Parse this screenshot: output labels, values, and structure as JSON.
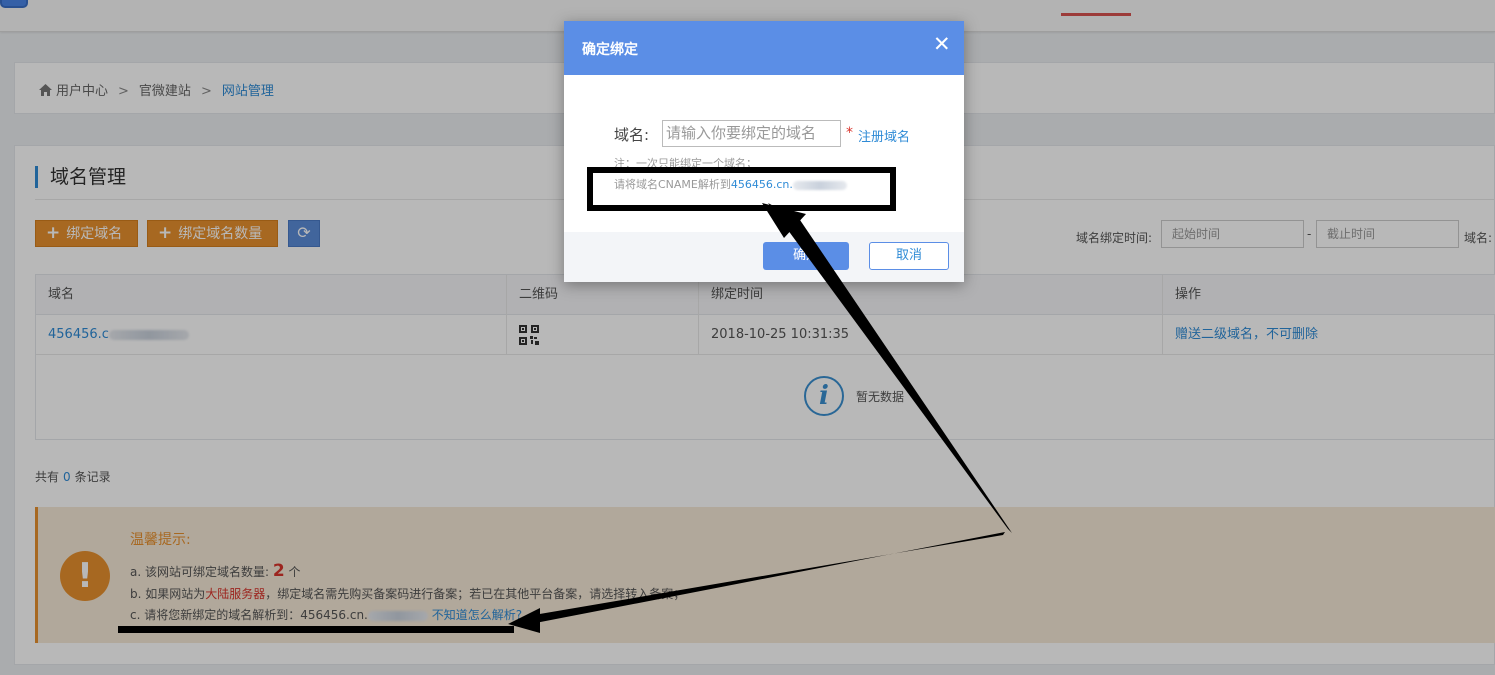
{
  "breadcrumb": {
    "home": "用户中心",
    "separator": ">",
    "mid": "官微建站",
    "current": "网站管理"
  },
  "section": {
    "title": "域名管理"
  },
  "toolbar": {
    "bind_domain": "绑定域名",
    "bind_quantity": "绑定域名数量",
    "refresh_icon": "refresh-icon",
    "bind_time_label": "域名绑定时间:",
    "start_placeholder": "起始时间",
    "range_dash": "-",
    "end_placeholder": "截止时间",
    "domain_label": "域名:"
  },
  "table": {
    "headers": [
      "域名",
      "二维码",
      "绑定时间",
      "操作"
    ],
    "row": {
      "domain": "456456.c",
      "bind_time": "2018-10-25 10:31:35",
      "action": "赠送二级域名，不可删除"
    },
    "empty_text": "暂无数据"
  },
  "records": {
    "prefix": "共有",
    "count": "0",
    "suffix": "条记录"
  },
  "tip": {
    "title": "温馨提示:",
    "line_a_prefix": "a. 该网站可绑定域名数量:",
    "line_a_count": "2",
    "line_a_suffix": "个",
    "line_b_prefix": "b. 如果网站为",
    "line_b_red": "大陆服务器",
    "line_b_suffix": "，绑定域名需先购买备案码进行备案；若已在其他平台备案，请选择转入备案；",
    "line_c_prefix": "c. 请将您新绑定的域名解析到：456456.cn.",
    "line_c_link": "不知道怎么解析?"
  },
  "modal": {
    "title": "确定绑定",
    "close": "✕",
    "label": "域名:",
    "input_placeholder": "请输入你要绑定的域名",
    "required": "*",
    "register_link": "注册域名",
    "note": "注：一次只能绑定一个域名；",
    "cname_prefix": "请将域名CNAME解析到",
    "cname_link": "456456.cn.",
    "ok": "确定",
    "cancel": "取消"
  },
  "colors": {
    "accent_blue": "#5b8ee6",
    "link_blue": "#2f8bd6",
    "orange": "#e8912f",
    "red": "#d9342b"
  }
}
